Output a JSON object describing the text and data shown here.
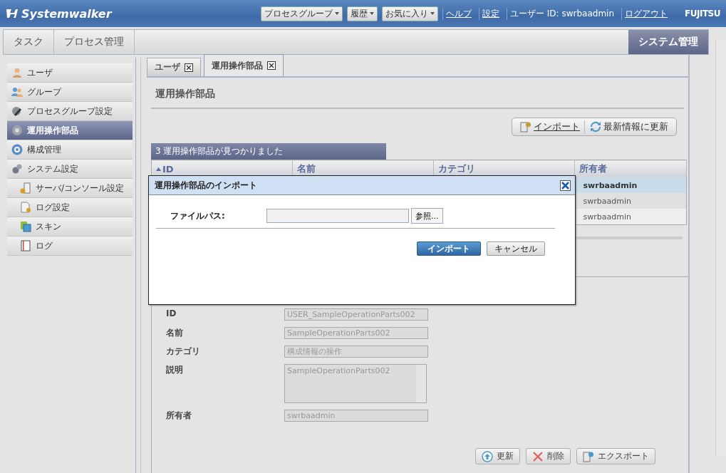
{
  "header": {
    "logo": "Systemwalker",
    "menus": [
      {
        "label": "プロセスグループ"
      },
      {
        "label": "履歴"
      },
      {
        "label": "お気に入り"
      }
    ],
    "links": [
      "ヘルプ",
      "設定"
    ],
    "user_label": "ユーザー ID: swrbaadmin",
    "logout": "ログアウト",
    "brand": "FUJITSU"
  },
  "nav_tabs": [
    {
      "label": "タスク",
      "selected": false
    },
    {
      "label": "プロセス管理",
      "selected": false
    },
    {
      "label": "システム管理",
      "selected": true
    }
  ],
  "sidebar": {
    "items": [
      {
        "label": "ユーザ",
        "kind": "user",
        "selected": false
      },
      {
        "label": "グループ",
        "kind": "group",
        "selected": false
      },
      {
        "label": "プロセスグループ設定",
        "kind": "tools",
        "selected": false
      },
      {
        "label": "運用操作部品",
        "kind": "gear",
        "selected": true
      },
      {
        "label": "構成管理",
        "kind": "ci",
        "selected": false
      },
      {
        "label": "システム設定",
        "kind": "gears",
        "selected": false,
        "children": [
          {
            "label": "サーバ/コンソール設定",
            "kind": "server",
            "selected": false
          },
          {
            "label": "ログ設定",
            "kind": "doc",
            "selected": false
          },
          {
            "label": "スキン",
            "kind": "skin",
            "selected": false
          },
          {
            "label": "ログ",
            "kind": "book",
            "selected": false
          }
        ]
      }
    ]
  },
  "content_tabs": [
    {
      "label": "ユーザ",
      "selected": false
    },
    {
      "label": "運用操作部品",
      "selected": true
    }
  ],
  "page_title": "運用操作部品",
  "toolbar": [
    {
      "label": "インポート",
      "kind": "link"
    },
    {
      "label": "最新情報に更新",
      "kind": "refresh"
    }
  ],
  "result_banner": "3 運用操作部品が見つかりました",
  "table": {
    "columns": [
      {
        "label": "ID",
        "sorted": true
      },
      {
        "label": "名前",
        "sorted": false
      },
      {
        "label": "カテゴリ",
        "sorted": false
      },
      {
        "label": "所有者",
        "sorted": false
      }
    ],
    "rows": [
      {
        "owner": "swrbaadmin",
        "selected": true
      },
      {
        "owner": "swrbaadmin",
        "selected": false
      },
      {
        "owner": "swrbaadmin",
        "selected": false
      }
    ]
  },
  "details": {
    "fields": [
      {
        "label": "ID",
        "value": "USER_SampleOperationParts002",
        "kind": "input"
      },
      {
        "label": "名前",
        "value": "SampleOperationParts002",
        "kind": "input"
      },
      {
        "label": "カテゴリ",
        "value": "構成情報の操作",
        "kind": "input"
      },
      {
        "label": "説明",
        "value": "SampleOperationParts002",
        "kind": "textarea"
      },
      {
        "label": "所有者",
        "value": "swrbaadmin",
        "kind": "input"
      }
    ],
    "buttons": [
      {
        "label": "更新",
        "kind": "upload"
      },
      {
        "label": "削除",
        "kind": "delete"
      },
      {
        "label": "エクスポート",
        "kind": "export"
      }
    ]
  },
  "dialog": {
    "title": "運用操作部品のインポート",
    "field_label": "ファイルパス:",
    "browse": "参照...",
    "buttons": [
      {
        "label": "インポート",
        "kind": "primary"
      },
      {
        "label": "キャンセル",
        "kind": "secondary"
      }
    ]
  }
}
